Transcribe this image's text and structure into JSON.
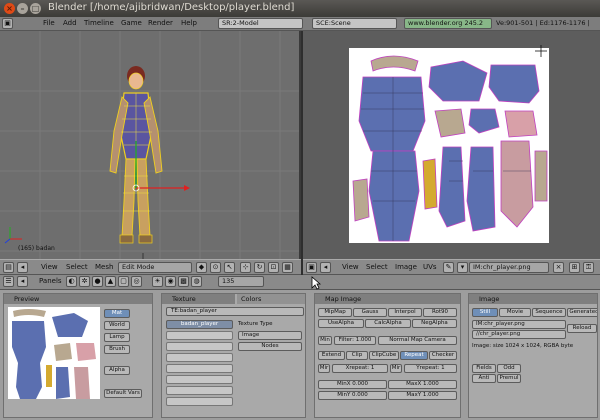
{
  "window": {
    "title": "Blender [/home/ajibridwan/Desktop/player.blend]"
  },
  "topbar": {
    "menus": [
      "File",
      "Add",
      "Timeline",
      "Game",
      "Render",
      "Help"
    ],
    "screen": "SR:2-Model",
    "scene": "SCE:Scene",
    "url": "www.blender.org 245.2",
    "status": "Ve:901-501 | Ed:1176-1176 |"
  },
  "view3d": {
    "object_label": "(165) badan"
  },
  "view3d_header": {
    "menus": [
      "View",
      "Select",
      "Mesh"
    ],
    "mode": "Edit Mode"
  },
  "uv_header": {
    "menus": [
      "View",
      "Select",
      "Image",
      "UVs"
    ],
    "image_name": "IM:chr_player.png"
  },
  "buttons_header": {
    "panels_label": "Panels",
    "frame": "135"
  },
  "preview": {
    "title": "Preview",
    "buttons": [
      "Mat",
      "World",
      "Lamp",
      "Brush",
      "Alpha",
      "Default Vars"
    ]
  },
  "texture": {
    "tab_texture": "Texture",
    "tab_colors": "Colors",
    "tex_field": "TE:badan_player",
    "tex_slot": "badan_player",
    "type_label": "Texture Type",
    "type_value": "Image",
    "nodes": "Nodes"
  },
  "mapimage": {
    "title": "Map Image",
    "row1": [
      "MipMap",
      "Gauss",
      "Interpol",
      "Rot90"
    ],
    "row2": [
      "UseAlpha",
      "CalcAlpha",
      "NegAlpha"
    ],
    "min": "Min",
    "filter": "Filter: 1.000",
    "normal_map": "Normal Map Camera",
    "row4": [
      "Extend",
      "Clip",
      "ClipCube",
      "Repeat",
      "Checker"
    ],
    "xrepeat": "Xrepeat: 1",
    "yrepeat": "Yrepeat: 1",
    "minx": "MinX 0.000",
    "maxx": "MaxX 1.000",
    "miny": "MinY 0.000",
    "maxy": "MaxY 1.000"
  },
  "image": {
    "title": "Image",
    "tabs": [
      "Still",
      "Movie",
      "Sequence",
      "Generated"
    ],
    "field1": "IM:chr_player.png",
    "field2": "//chr_player.png",
    "reload": "Reload",
    "info": "Image: size 1024 x 1024, RGBA byte",
    "fields": "Fields",
    "odd": "Odd",
    "antialias": "Anti",
    "premul": "Premul"
  },
  "colors": {
    "accent_blue": "#6f8fb8",
    "panel_bg": "#a9a9a9",
    "viewport_bg": "#6e6e6e"
  }
}
